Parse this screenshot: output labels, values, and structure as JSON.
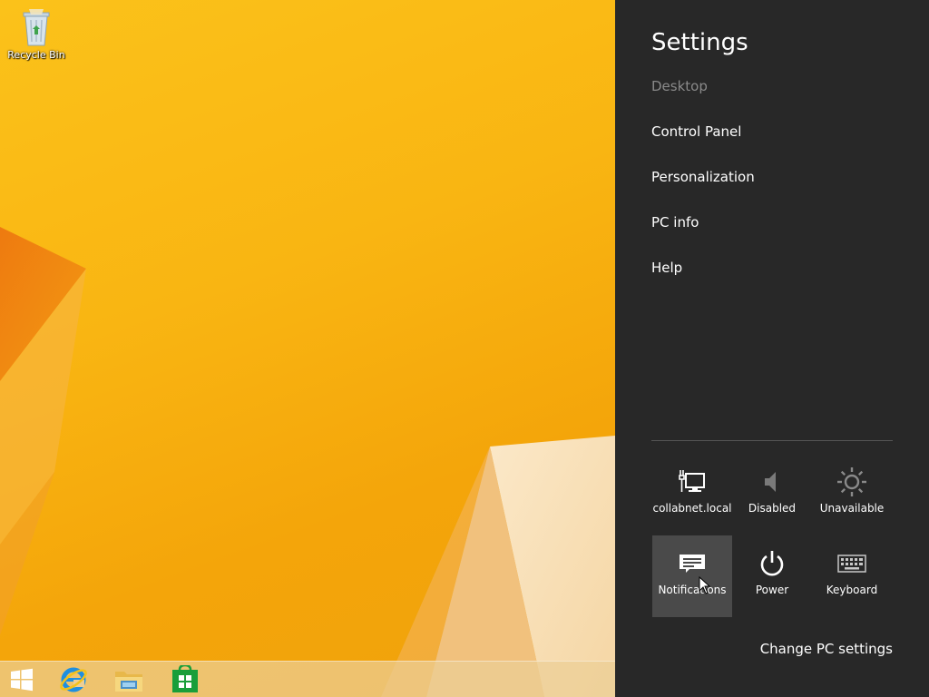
{
  "desktop": {
    "icons": [
      {
        "label": "Recycle Bin",
        "icon": "recycle-bin-icon"
      }
    ]
  },
  "taskbar": {
    "items": [
      {
        "name": "start",
        "icon": "windows-logo-icon"
      },
      {
        "name": "internet-explorer",
        "icon": "internet-explorer-icon"
      },
      {
        "name": "file-explorer",
        "icon": "folder-icon"
      },
      {
        "name": "store",
        "icon": "store-icon"
      }
    ]
  },
  "charms": {
    "title": "Settings",
    "context": "Desktop",
    "menu": [
      {
        "label": "Control Panel"
      },
      {
        "label": "Personalization"
      },
      {
        "label": "PC info"
      },
      {
        "label": "Help"
      }
    ],
    "quick": [
      {
        "label": "collabnet.local",
        "icon": "network-icon"
      },
      {
        "label": "Disabled",
        "icon": "volume-icon"
      },
      {
        "label": "Unavailable",
        "icon": "brightness-icon"
      },
      {
        "label": "Notifications",
        "icon": "notifications-icon",
        "selected": true
      },
      {
        "label": "Power",
        "icon": "power-icon"
      },
      {
        "label": "Keyboard",
        "icon": "keyboard-icon"
      }
    ],
    "change_pc_settings": "Change PC settings"
  },
  "colors": {
    "charms_bg": "#282828",
    "selected_tile": "#4a4a4a",
    "wallpaper": "#f9b512"
  }
}
